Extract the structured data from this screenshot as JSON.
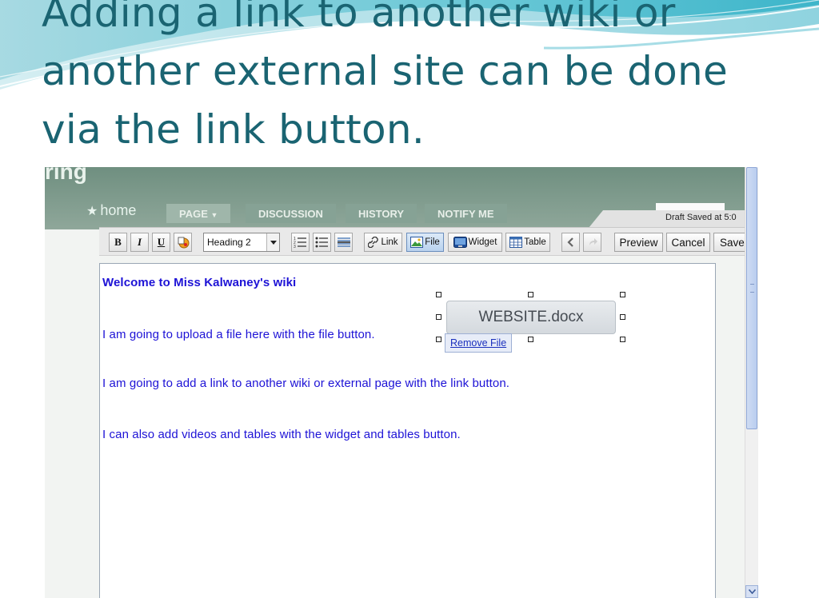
{
  "slide": {
    "title": "Adding a link to another wiki or another external site can be done via the link button."
  },
  "wiki": {
    "name": "ring",
    "nav": {
      "home": "home",
      "tabs": [
        "PAGE",
        "DISCUSSION",
        "HISTORY",
        "NOTIFY ME"
      ],
      "selected_tab": "PAGE"
    },
    "draft_status": "Draft Saved at 5:0"
  },
  "toolbar": {
    "bold": "B",
    "italic": "I",
    "underline": "U",
    "format_select": "Heading 2",
    "link": "Link",
    "file": "File",
    "widget": "Widget",
    "table": "Table",
    "preview": "Preview",
    "cancel": "Cancel",
    "save": "Save"
  },
  "editor": {
    "lines": [
      "Welcome to Miss Kalwaney's wiki",
      "I am going to upload a file here with the file button.",
      "I am going to add a link to another wiki or external page with the link button.",
      "I can also add videos and tables with the widget and tables button."
    ],
    "file_chip": "WEBSITE.docx",
    "remove_file": "Remove File"
  },
  "colors": {
    "title": "#1a6472",
    "editor_text": "#1d12d6",
    "wiki_header": "#7c9a8c"
  }
}
